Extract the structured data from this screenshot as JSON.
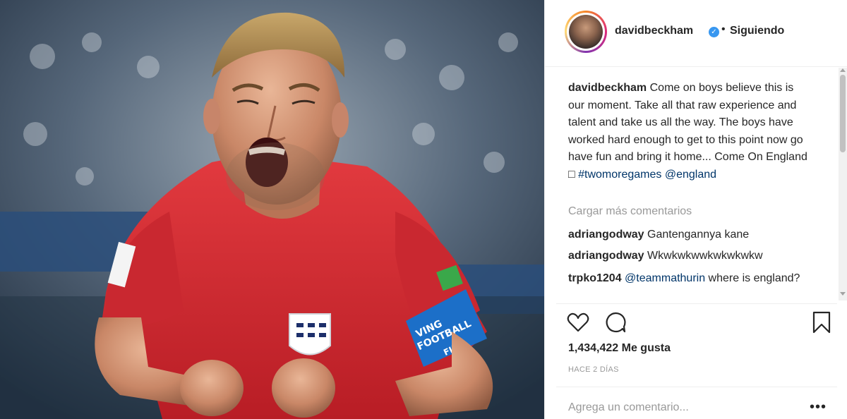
{
  "post": {
    "image_alt": "Jugador de Inglaterra celebrando con camiseta roja",
    "armband_text": [
      "VING",
      "FOOTBALL",
      "FIFA"
    ]
  },
  "header": {
    "username": "davidbeckham",
    "separator": "•",
    "follow_label": "Siguiendo"
  },
  "caption": {
    "username": "davidbeckham",
    "text": "Come on boys believe this is our moment. Take all that raw experience and talent and take us all the way. The boys have worked hard enough to get to this point now go have fun and bring it home... Come On England □ ",
    "hashtag": "#twomoregames",
    "mention": "@england"
  },
  "load_more": "Cargar más comentarios",
  "comments": [
    {
      "username": "adriangodway",
      "text": "Gantengannya kane"
    },
    {
      "username": "adriangodway",
      "text": "Wkwkwkwwkwkwkwkw"
    },
    {
      "username": "trpko1204",
      "mention": "@teammathurin",
      "text": " where is england?"
    }
  ],
  "actions": {
    "like_icon": "heart-icon",
    "comment_icon": "comment-bubble-icon",
    "save_icon": "bookmark-icon"
  },
  "likes": "1,434,422 Me gusta",
  "timestamp": "HACE 2 DÍAS",
  "add_comment_placeholder": "Agrega un comentario...",
  "more_options": "•••",
  "colors": {
    "verified": "#3897f0",
    "link": "#003569",
    "muted": "#999999",
    "shirt": "#d8282f"
  }
}
